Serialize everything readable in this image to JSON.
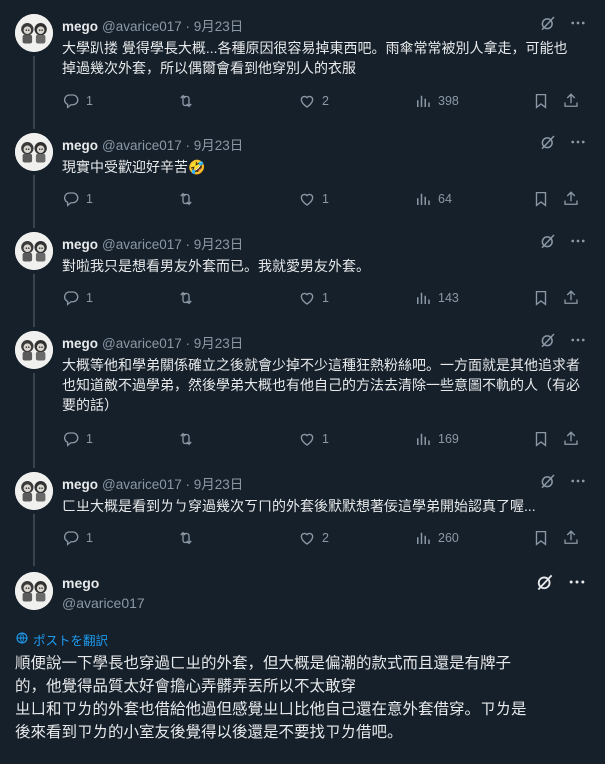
{
  "tweets": [
    {
      "name": "mego",
      "meta": "@avarice017 · 9月23日",
      "text": "大學趴搂 覺得學長大概...各種原因很容易掉東西吧。雨傘常常被別人拿走，可能也掉過幾次外套，所以偶爾會看到他穿別人的衣服",
      "replies": "1",
      "retweets": "",
      "likes": "2",
      "views": "398"
    },
    {
      "name": "mego",
      "meta": "@avarice017 · 9月23日",
      "text": "現實中受歡迎好辛苦🤣",
      "replies": "1",
      "retweets": "",
      "likes": "1",
      "views": "64"
    },
    {
      "name": "mego",
      "meta": "@avarice017 · 9月23日",
      "text": "對啦我只是想看男友外套而已。我就愛男友外套。",
      "replies": "1",
      "retweets": "",
      "likes": "1",
      "views": "143"
    },
    {
      "name": "mego",
      "meta": "@avarice017 · 9月23日",
      "text": "大概等他和學弟關係確立之後就會少掉不少這種狂熱粉絲吧。一方面就是其他追求者也知道敵不過學弟，然後學弟大概也有他自己的方法去清除一些意圖不軌的人（有必要的話）",
      "replies": "1",
      "retweets": "",
      "likes": "1",
      "views": "169"
    },
    {
      "name": "mego",
      "meta": "@avarice017 · 9月23日",
      "text": "ㄈㄓ大概是看到ㄌㄅ穿過幾次ㄎㄇ的外套後默默想著佞這學弟開始認真了喔...",
      "replies": "1",
      "retweets": "",
      "likes": "2",
      "views": "260"
    }
  ],
  "focus": {
    "name": "mego",
    "handle": "@avarice017",
    "translate_label": "ポストを翻訳",
    "lines": [
      "順便說一下學長也穿過ㄈㄓ的外套，但大概是偏潮的款式而且還是有牌子",
      "的，他覺得品質太好會擔心弄髒弄丟所以不太敢穿",
      "ㄓㄩ和ㄗㄌ的外套也借給他過但感覺ㄓㄩ比他自己還在意外套借穿。ㄗㄌ是",
      "後來看到ㄗㄌ的小室友後覺得以後還是不要找ㄗㄌ借吧。"
    ]
  },
  "colors": {
    "background": "#15202b",
    "text": "#e7e9ea",
    "muted": "#8b98a5",
    "accent": "#1d9bf0",
    "thread_line": "#38444d"
  },
  "icons": [
    "reply-icon",
    "retweet-icon",
    "like-icon",
    "views-icon",
    "bookmark-icon",
    "share-icon",
    "grok-icon",
    "more-icon",
    "globe-icon"
  ]
}
